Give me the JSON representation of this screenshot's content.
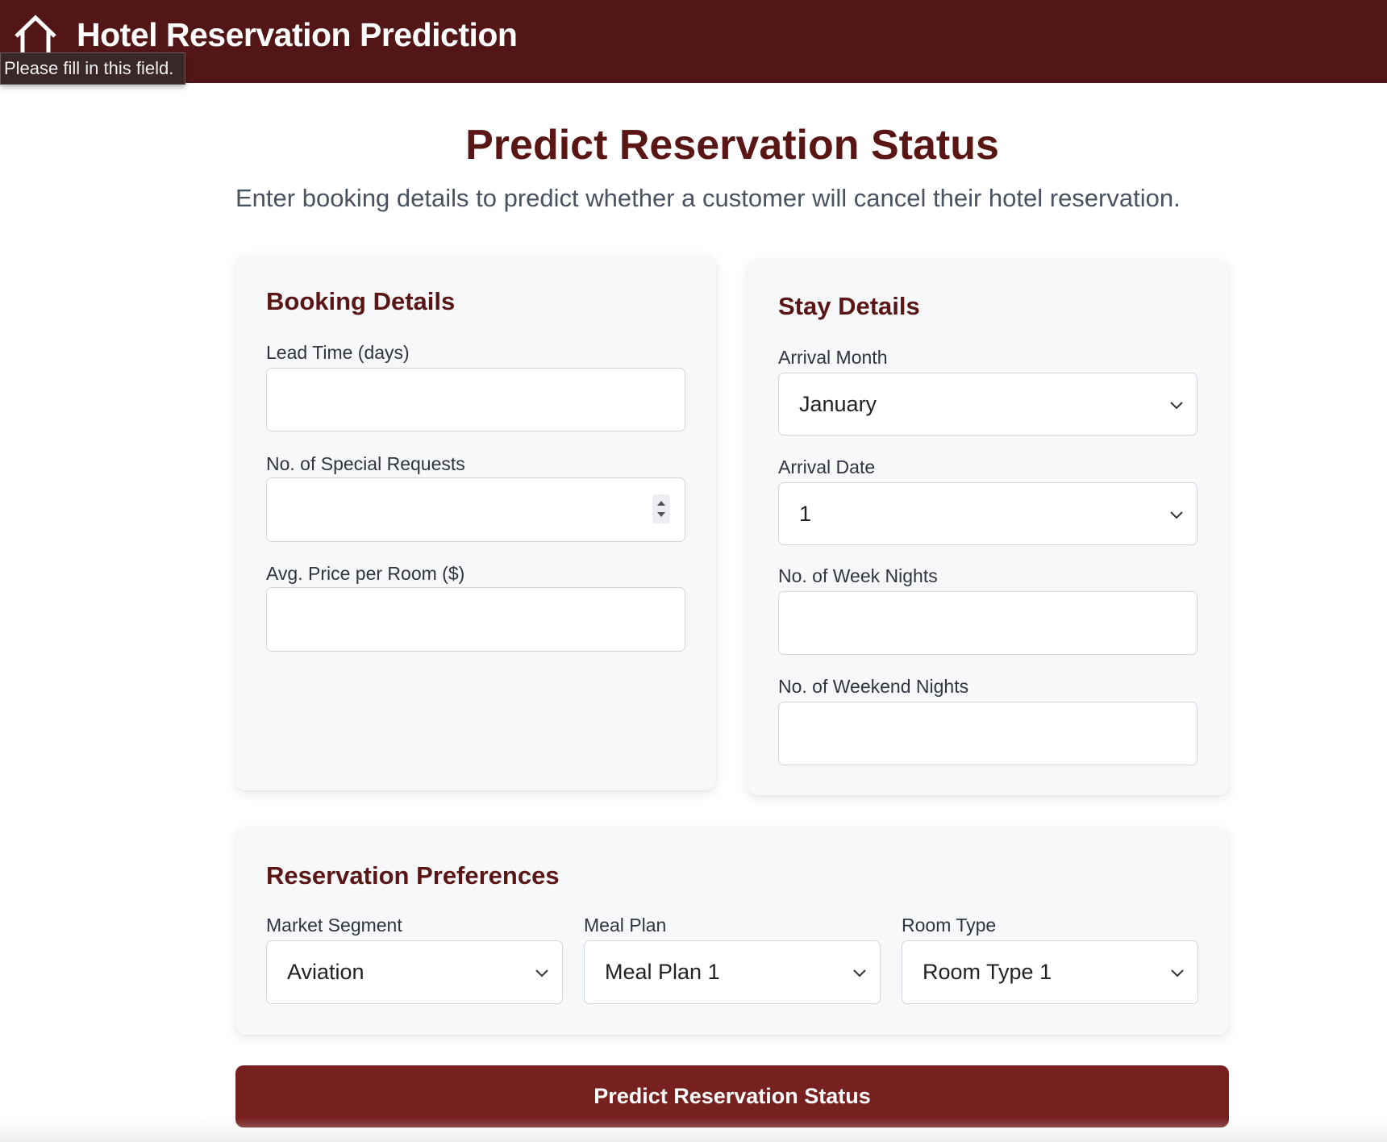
{
  "header": {
    "title": "Hotel Reservation Prediction",
    "home_icon": "home-icon",
    "background": "#521616"
  },
  "tooltip": {
    "text": "Please fill in this field."
  },
  "main": {
    "heading": "Predict Reservation Status",
    "subheading": "Enter booking details to predict whether a customer will cancel their hotel reservation."
  },
  "booking": {
    "title": "Booking Details",
    "lead_time_label": "Lead Time (days)",
    "lead_time_value": "",
    "special_requests_label": "No. of Special Requests",
    "special_requests_value": "",
    "avg_price_label": "Avg. Price per Room ($)",
    "avg_price_value": ""
  },
  "stay": {
    "title": "Stay Details",
    "arrival_month_label": "Arrival Month",
    "arrival_month_value": "January",
    "arrival_date_label": "Arrival Date",
    "arrival_date_value": "1",
    "week_nights_label": "No. of Week Nights",
    "week_nights_value": "",
    "weekend_nights_label": "No. of Weekend Nights",
    "weekend_nights_value": ""
  },
  "preferences": {
    "title": "Reservation Preferences",
    "market_segment_label": "Market Segment",
    "market_segment_value": "Aviation",
    "meal_plan_label": "Meal Plan",
    "meal_plan_value": "Meal Plan 1",
    "room_type_label": "Room Type",
    "room_type_value": "Room Type 1"
  },
  "submit": {
    "label": "Predict Reservation Status",
    "color": "#762020"
  },
  "colors": {
    "accent": "#5a1515",
    "card_bg": "#f7f8fa"
  }
}
